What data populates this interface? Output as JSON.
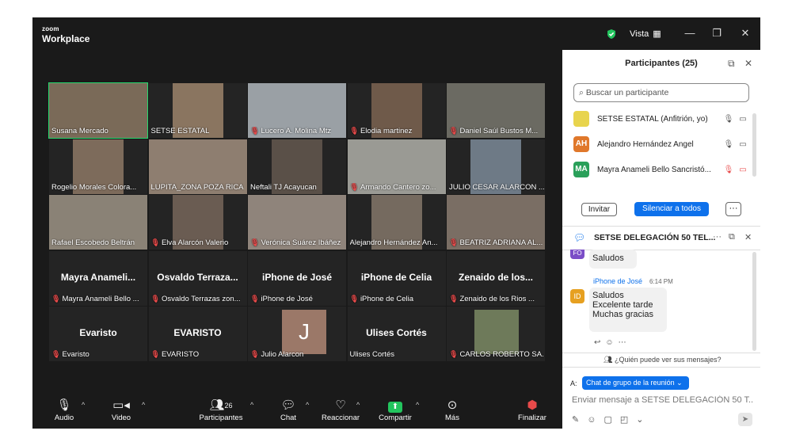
{
  "app": {
    "logo_top": "zoom",
    "logo_bottom": "Workplace",
    "view_label": "Vista"
  },
  "tiles": [
    {
      "name": "Susana Mercado",
      "muted": false,
      "type": "video",
      "active": true
    },
    {
      "name": "SETSE ESTATAL",
      "muted": false,
      "type": "video"
    },
    {
      "name": "Lucero A. Molina Mtz",
      "muted": true,
      "type": "video"
    },
    {
      "name": "Elodia martinez",
      "muted": true,
      "type": "video"
    },
    {
      "name": "Daniel Saúl Bustos M...",
      "muted": true,
      "type": "video"
    },
    {
      "name": "Rogelio Morales Colora...",
      "muted": false,
      "type": "video"
    },
    {
      "name": "LUPITA_ZONA POZA RICA",
      "muted": false,
      "type": "video"
    },
    {
      "name": "Neftali TJ Acayucan",
      "muted": false,
      "type": "video"
    },
    {
      "name": "Armando Cantero zo...",
      "muted": true,
      "type": "video"
    },
    {
      "name": "JULIO CESAR ALARCON ...",
      "muted": false,
      "type": "video"
    },
    {
      "name": "Rafael Escobedo Beltrán",
      "muted": false,
      "type": "video"
    },
    {
      "name": "Elva Alarcón Valerio",
      "muted": true,
      "type": "video"
    },
    {
      "name": "Verónica Suárez Ibáñez",
      "muted": true,
      "type": "video"
    },
    {
      "name": "Alejandro Hernández An...",
      "muted": false,
      "type": "video"
    },
    {
      "name": "BEATRIZ ADRIANA AL...",
      "muted": true,
      "type": "video"
    },
    {
      "name": "Mayra Anameli Bello ...",
      "muted": true,
      "type": "name",
      "big": "Mayra Anameli..."
    },
    {
      "name": "Osvaldo Terrazas zon...",
      "muted": true,
      "type": "name",
      "big": "Osvaldo Terraza..."
    },
    {
      "name": "iPhone de José",
      "muted": true,
      "type": "name",
      "big": "iPhone de José"
    },
    {
      "name": "iPhone de Celia",
      "muted": true,
      "type": "name",
      "big": "iPhone de Celia"
    },
    {
      "name": "Zenaido de los Rios ...",
      "muted": true,
      "type": "name",
      "big": "Zenaido de los..."
    },
    {
      "name": "Evaristo",
      "muted": true,
      "type": "name",
      "big": "Evaristo"
    },
    {
      "name": "EVARISTO",
      "muted": true,
      "type": "name",
      "big": "EVARISTO"
    },
    {
      "name": "Julio Alarcon",
      "muted": true,
      "type": "avatar",
      "letter": "J"
    },
    {
      "name": "Ulises Cortés",
      "muted": false,
      "type": "name",
      "big": "Ulises Cortés"
    },
    {
      "name": "CARLOS ROBERTO SA...",
      "muted": true,
      "type": "blur"
    }
  ],
  "toolbar": {
    "audio": "Audio",
    "video": "Video",
    "participants": "Participantes",
    "participants_count": "26",
    "chat": "Chat",
    "react": "Reaccionar",
    "share": "Compartir",
    "more": "Más",
    "end": "Finalizar"
  },
  "participants": {
    "title": "Participantes (25)",
    "search_placeholder": "Buscar un participante",
    "list": [
      {
        "initials": "",
        "name": "SETSE ESTATAL (Anfitrión, yo)",
        "color": "#e8d44d"
      },
      {
        "initials": "AH",
        "name": "Alejandro Hernández Angel",
        "color": "#e0782b"
      },
      {
        "initials": "MA",
        "name": "Mayra Anameli Bello Sancristó...",
        "color": "#2aa05a"
      }
    ],
    "invite": "Invitar",
    "mute_all": "Silenciar a todos"
  },
  "chat": {
    "title": "SETSE DELEGACIÓN 50 TEL...",
    "prev_initials": "FO",
    "prev_msg": "Saludos",
    "sender": "iPhone de José",
    "time": "6:14 PM",
    "sender_initials": "ID",
    "lines": [
      "Saludos",
      "Excelente tarde",
      "Muchas gracias"
    ],
    "who_can_see": "¿Quién puede ver sus mensajes?",
    "to_label": "A:",
    "to_value": "Chat de grupo de la reunión",
    "placeholder": "Enviar mensaje a SETSE DELEGACIÓN 50 T..."
  }
}
